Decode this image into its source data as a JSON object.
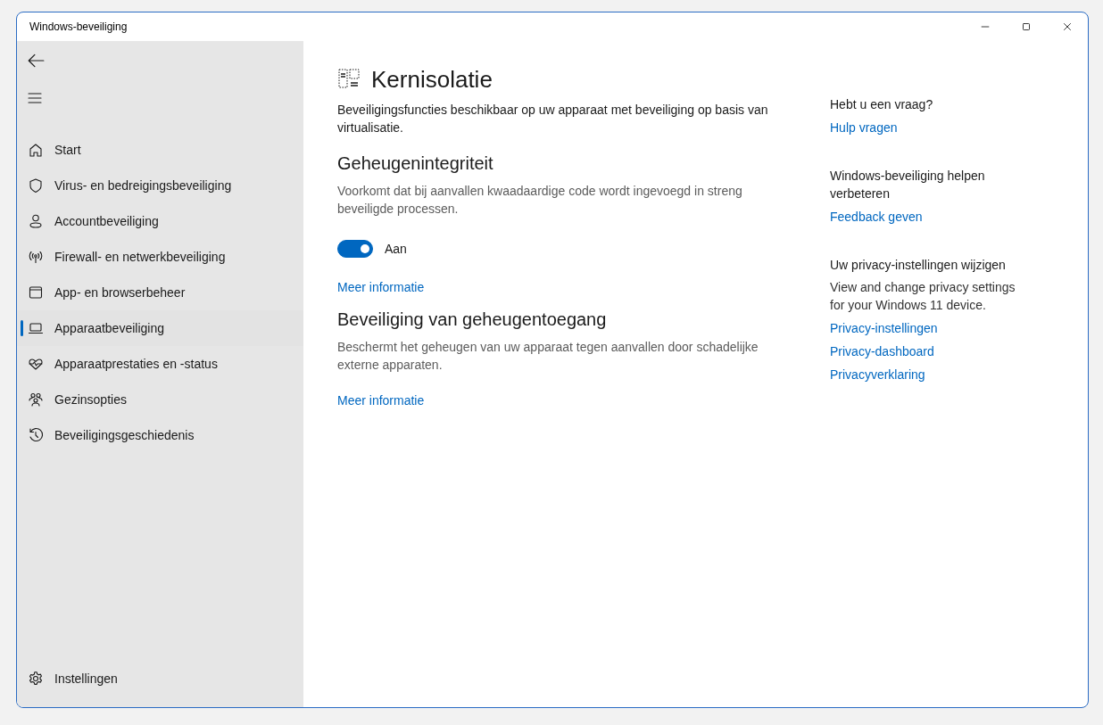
{
  "window": {
    "title": "Windows-beveiliging"
  },
  "sidebar": {
    "items": [
      {
        "label": "Start",
        "selected": false
      },
      {
        "label": "Virus- en bedreigingsbeveiliging",
        "selected": false
      },
      {
        "label": "Accountbeveiliging",
        "selected": false
      },
      {
        "label": "Firewall- en netwerkbeveiliging",
        "selected": false
      },
      {
        "label": "App- en browserbeheer",
        "selected": false
      },
      {
        "label": "Apparaatbeveiliging",
        "selected": true
      },
      {
        "label": "Apparaatprestaties en -status",
        "selected": false
      },
      {
        "label": "Gezinsopties",
        "selected": false
      },
      {
        "label": "Beveiligingsgeschiedenis",
        "selected": false
      }
    ],
    "footer_item": {
      "label": "Instellingen",
      "selected": false
    }
  },
  "page": {
    "title": "Kernisolatie",
    "description": "Beveiligingsfuncties beschikbaar op uw apparaat met beveiliging op basis van virtualisatie.",
    "sections": [
      {
        "heading": "Geheugenintegriteit",
        "description": "Voorkomt dat bij aanvallen kwaadaardige code wordt ingevoegd in streng beveiligde processen.",
        "toggle": {
          "on": true,
          "label": "Aan"
        },
        "link": "Meer informatie"
      },
      {
        "heading": "Beveiliging van geheugentoegang",
        "description": "Beschermt het geheugen van uw apparaat tegen aanvallen door schadelijke externe apparaten.",
        "link": "Meer informatie"
      }
    ]
  },
  "aside": {
    "groups": [
      {
        "heading": "Hebt u een vraag?",
        "links": [
          "Hulp vragen"
        ]
      },
      {
        "heading": "Windows-beveiliging helpen verbeteren",
        "links": [
          "Feedback geven"
        ]
      },
      {
        "heading": "Uw privacy-instellingen wijzigen",
        "text": "View and change privacy settings for your Windows 11 device.",
        "links": [
          "Privacy-instellingen",
          "Privacy-dashboard",
          "Privacyverklaring"
        ]
      }
    ]
  }
}
